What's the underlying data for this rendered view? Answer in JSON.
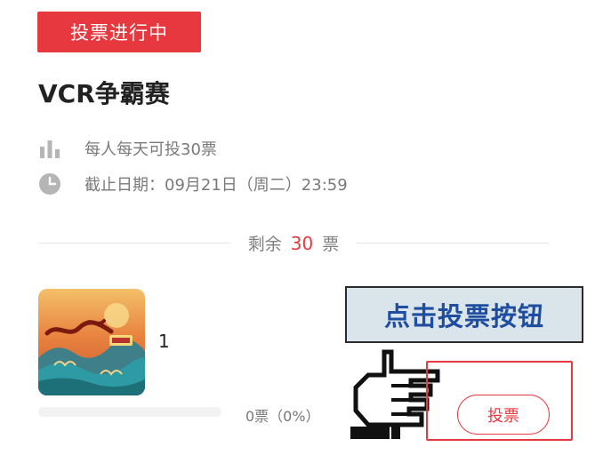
{
  "poll": {
    "status_label": "投票进行中",
    "title": "VCR争霸赛",
    "rule_text": "每人每天可投30票",
    "deadline_text": "截止日期：09月21日（周二）23:59",
    "remaining_prefix": "剩余",
    "remaining_count": "30",
    "remaining_suffix": "票"
  },
  "candidate": {
    "thumbnail_icon": "candidate-poster-image",
    "name": "1",
    "votes_text": "0票（0%）",
    "progress_fraction": 0,
    "vote_button_label": "投票"
  },
  "overlay": {
    "callout_text": "点击投票按钮",
    "pointer_icon": "pointing-hand-icon"
  },
  "colors": {
    "accent": "#e8383f",
    "callout_bg": "#d9e5ea",
    "callout_text": "#1f4ea0"
  }
}
